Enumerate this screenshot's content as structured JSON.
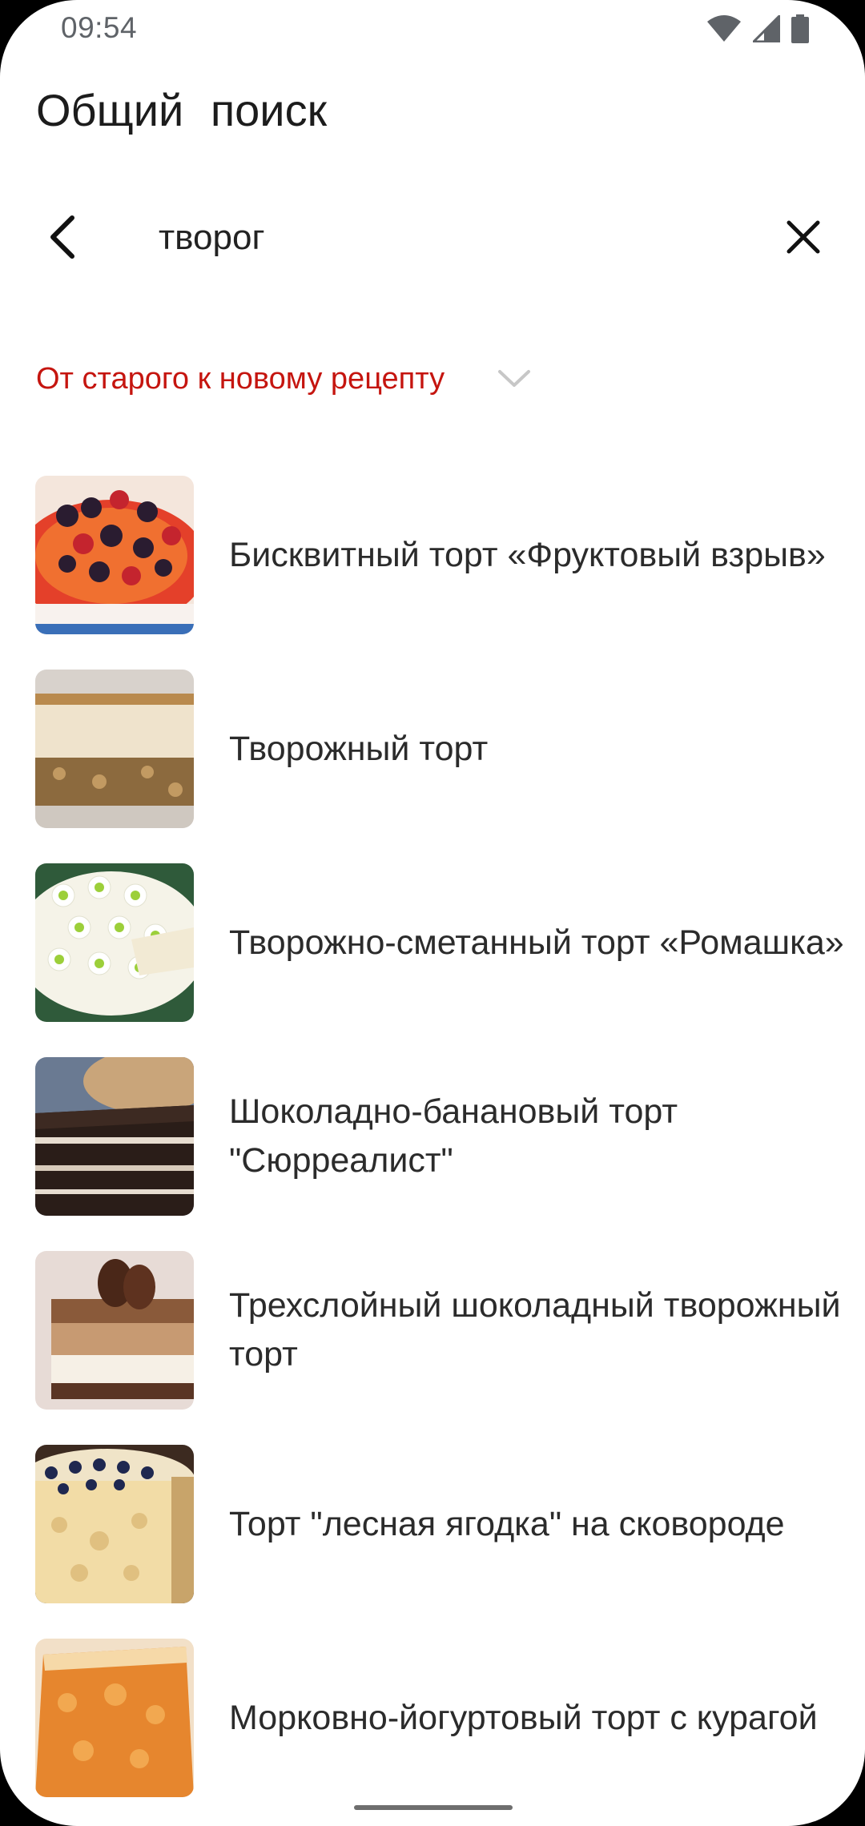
{
  "status_bar": {
    "time": "09:54",
    "icons": [
      "wifi-icon",
      "signal-icon",
      "battery-icon"
    ]
  },
  "header": {
    "title": "Общий поиск"
  },
  "search": {
    "value": "творог",
    "back_icon": "arrow-back-icon",
    "clear_icon": "close-icon"
  },
  "sort": {
    "label": "От старого к новому рецепту",
    "icon": "chevron-down-icon",
    "color": "#c5150f"
  },
  "recipes": [
    {
      "title": "Бисквитный торт «Фруктовый взрыв»"
    },
    {
      "title": "Творожный торт"
    },
    {
      "title": "Творожно-сметанный торт «Ромашка»"
    },
    {
      "title": "Шоколадно-банановый торт \"Сюрреалист\""
    },
    {
      "title": "Трехслойный шоколадный творожный торт"
    },
    {
      "title": "Торт \"лесная ягодка\" на сковороде"
    },
    {
      "title": "Морковно-йогуртовый торт с курагой"
    }
  ]
}
